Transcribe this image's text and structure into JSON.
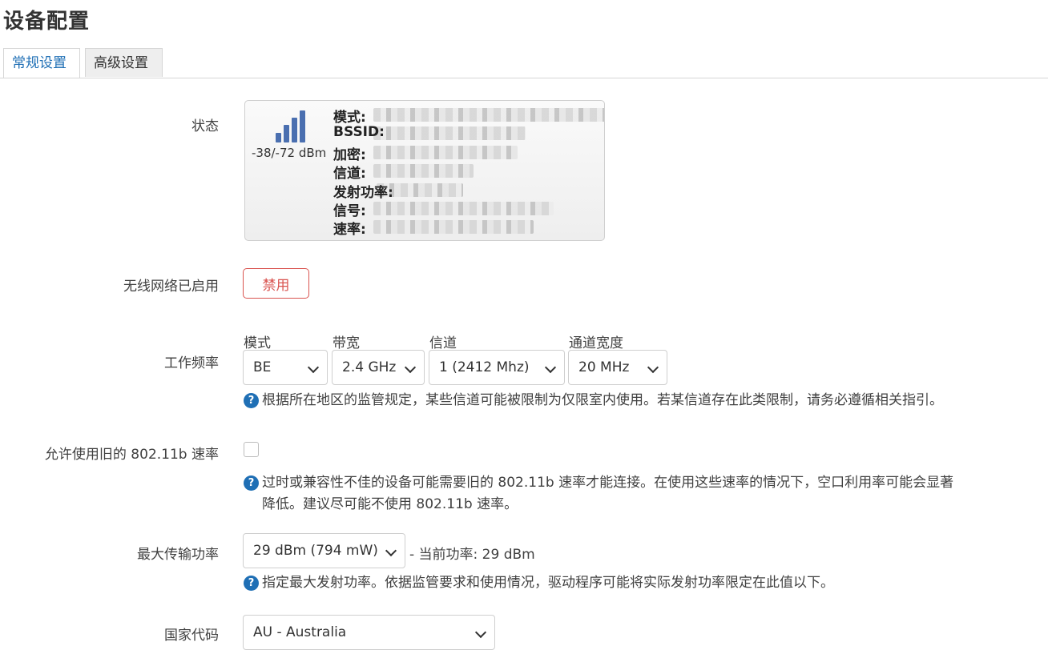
{
  "page": {
    "title": "设备配置"
  },
  "tabs": [
    {
      "label": "常规设置",
      "active": true
    },
    {
      "label": "高级设置",
      "active": false
    }
  ],
  "status": {
    "label": "状态",
    "signal_icon": "signal-bars-icon",
    "signal_text": "-38/-72 dBm",
    "fields": [
      "模式:",
      "BSSID:",
      "加密:",
      "信道:",
      "发射功率:",
      "信号:",
      "速率:"
    ]
  },
  "wireless": {
    "label": "无线网络已启用",
    "disable_button": "禁用"
  },
  "frequency": {
    "label": "工作频率",
    "mode": {
      "label": "模式",
      "value": "BE"
    },
    "band": {
      "label": "带宽",
      "value": "2.4 GHz"
    },
    "channel": {
      "label": "信道",
      "value": "1 (2412 Mhz)"
    },
    "width": {
      "label": "通道宽度",
      "value": "20 MHz"
    },
    "help": "根据所在地区的监管规定，某些信道可能被限制为仅限室内使用。若某信道存在此类限制，请务必遵循相关指引。"
  },
  "legacy": {
    "label": "允许使用旧的 802.11b 速率",
    "checked": false,
    "help_line1": "过时或兼容性不佳的设备可能需要旧的 802.11b 速率才能连接。在使用这些速率的情况下，空口利用率可能会显著",
    "help_line2": "降低。建议尽可能不使用 802.11b 速率。"
  },
  "txpower": {
    "label": "最大传输功率",
    "value": "29 dBm (794 mW)",
    "current": "- 当前功率: 29 dBm",
    "help": "指定最大发射功率。依据监管要求和使用情况，驱动程序可能将实际发射功率限定在此值以下。"
  },
  "country": {
    "label": "国家代码",
    "value": "AU - Australia"
  },
  "colors": {
    "accent": "#1f6fb5",
    "danger": "#d9534f",
    "signal": "#4a6fb0"
  }
}
